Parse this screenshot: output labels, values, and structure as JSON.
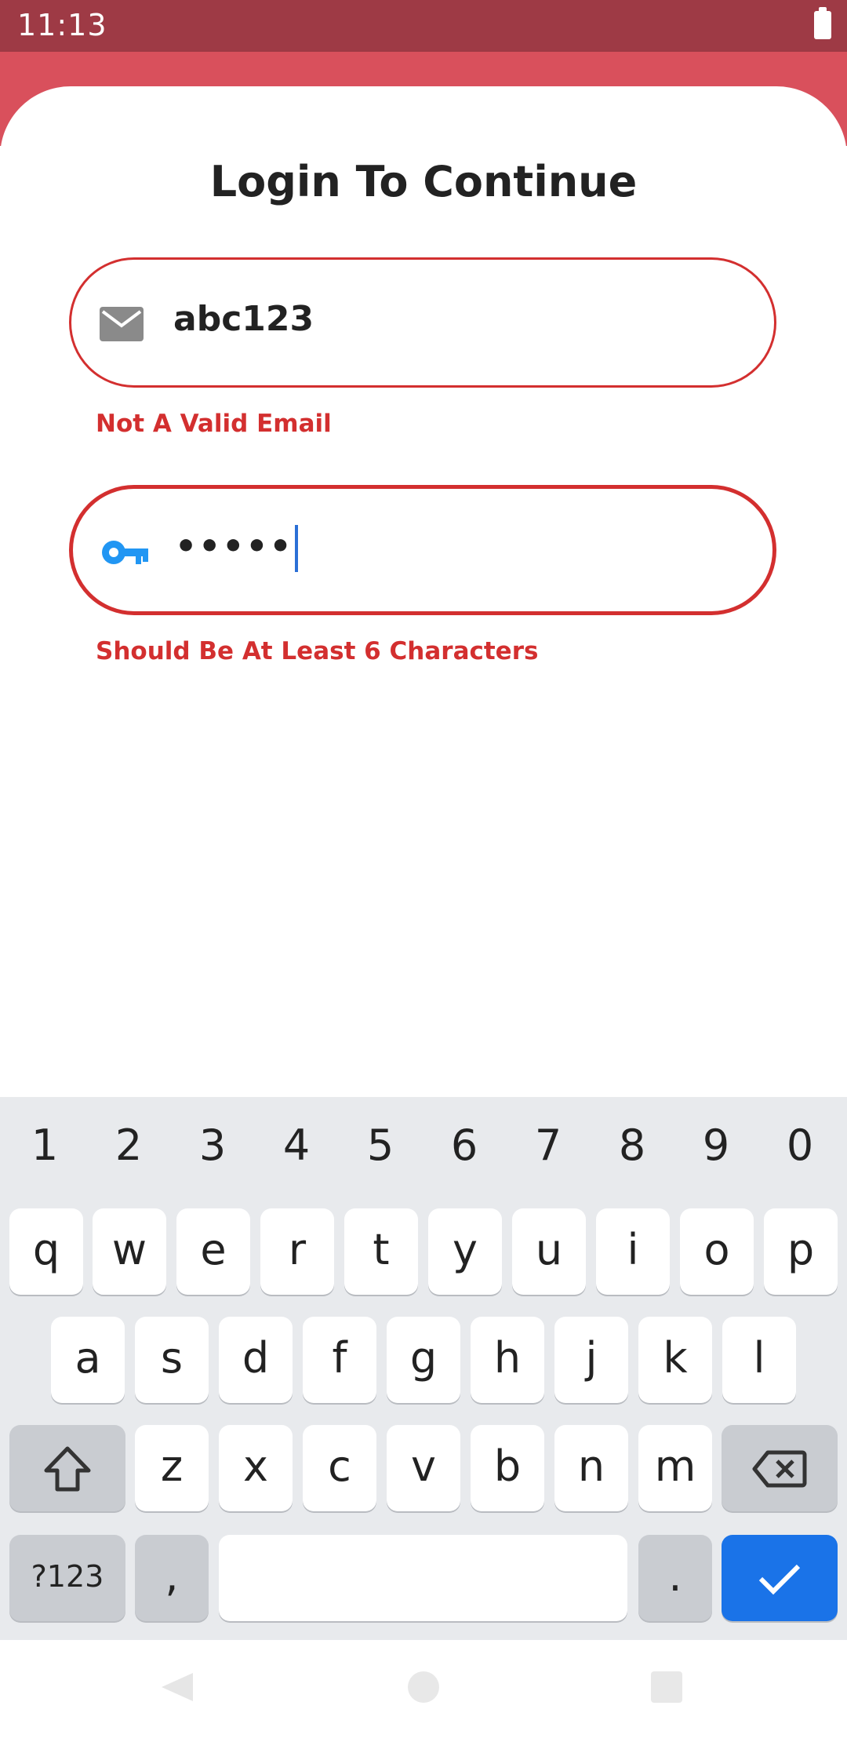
{
  "status_bar": {
    "time": "11:13"
  },
  "title": "Login To Continue",
  "email_field": {
    "value": "abc123",
    "error": "Not A Valid Email",
    "icon": "mail-icon"
  },
  "password_field": {
    "value": "•••••",
    "error": "Should Be At Least 6 Characters",
    "icon": "key-icon"
  },
  "colors": {
    "status_bar": "#9e3a45",
    "header": "#d9505c",
    "error": "#d32f2f",
    "key_icon": "#2196f3",
    "enter_key": "#1a73e8"
  },
  "keyboard": {
    "numbers": [
      "1",
      "2",
      "3",
      "4",
      "5",
      "6",
      "7",
      "8",
      "9",
      "0"
    ],
    "row1": [
      "q",
      "w",
      "e",
      "r",
      "t",
      "y",
      "u",
      "i",
      "o",
      "p"
    ],
    "row2": [
      "a",
      "s",
      "d",
      "f",
      "g",
      "h",
      "j",
      "k",
      "l"
    ],
    "row3": [
      "z",
      "x",
      "c",
      "v",
      "b",
      "n",
      "m"
    ],
    "symbols_label": "?123",
    "comma": ",",
    "period": "."
  }
}
